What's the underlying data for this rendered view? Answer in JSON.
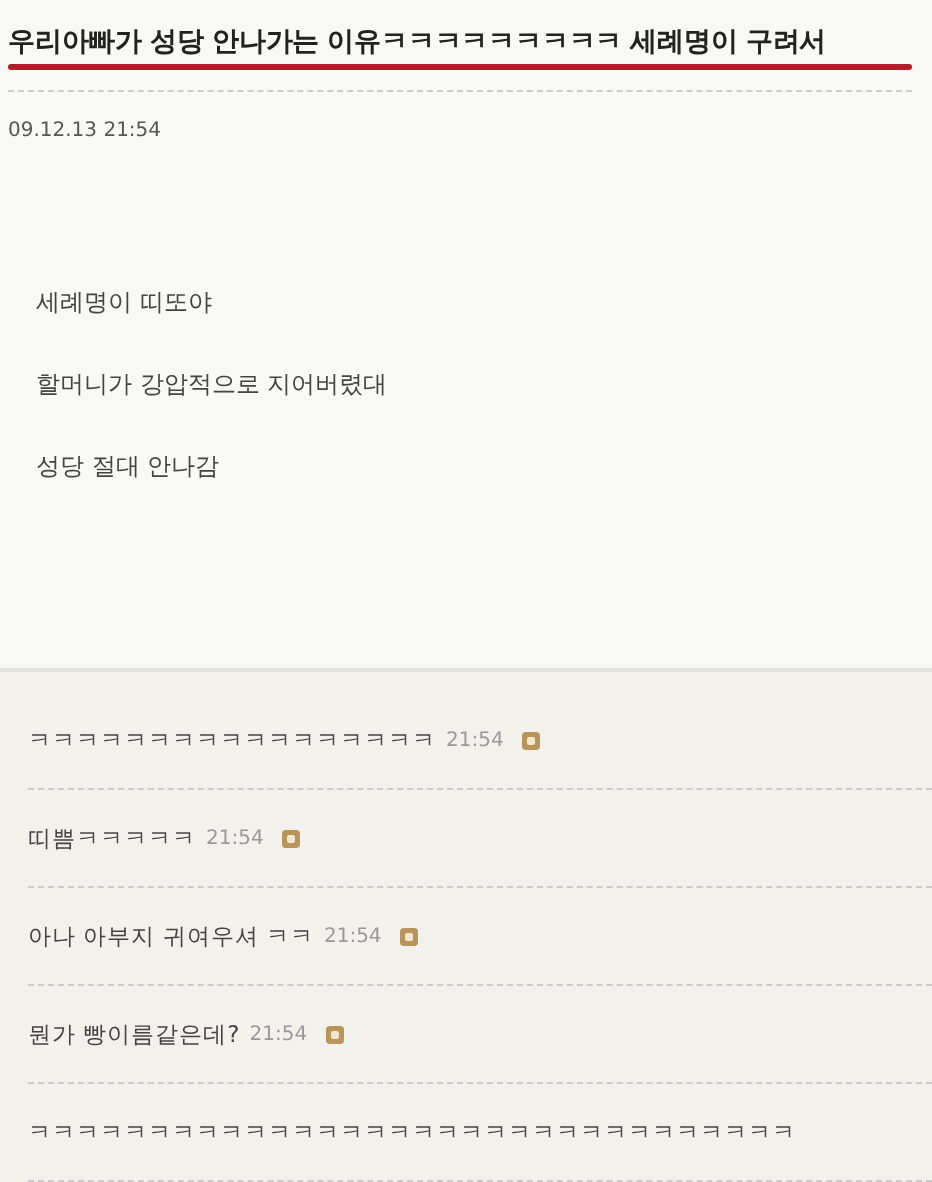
{
  "post": {
    "title": "우리아빠가 성당 안나가는 이유ㅋㅋㅋㅋㅋㅋㅋㅋㅋ 세례명이 구려서",
    "date": "09.12.13 21:54",
    "body": [
      "세례명이 띠또야",
      "할머니가 강압적으로 지어버렸대",
      "성당 절대 안나감"
    ]
  },
  "comments": [
    {
      "text": "ㅋㅋㅋㅋㅋㅋㅋㅋㅋㅋㅋㅋㅋㅋㅋㅋㅋ",
      "time": "21:54"
    },
    {
      "text": "띠쁨ㅋㅋㅋㅋㅋ",
      "time": "21:54"
    },
    {
      "text": "아나 아부지 귀여우셔 ㅋㅋ",
      "time": "21:54"
    },
    {
      "text": "뭔가 빵이름같은데?",
      "time": "21:54"
    },
    {
      "text": "ㅋㅋㅋㅋㅋㅋㅋㅋㅋㅋㅋㅋㅋㅋㅋㅋㅋㅋㅋㅋㅋㅋㅋㅋㅋㅋㅋㅋㅋㅋㅋㅋ"
    }
  ]
}
